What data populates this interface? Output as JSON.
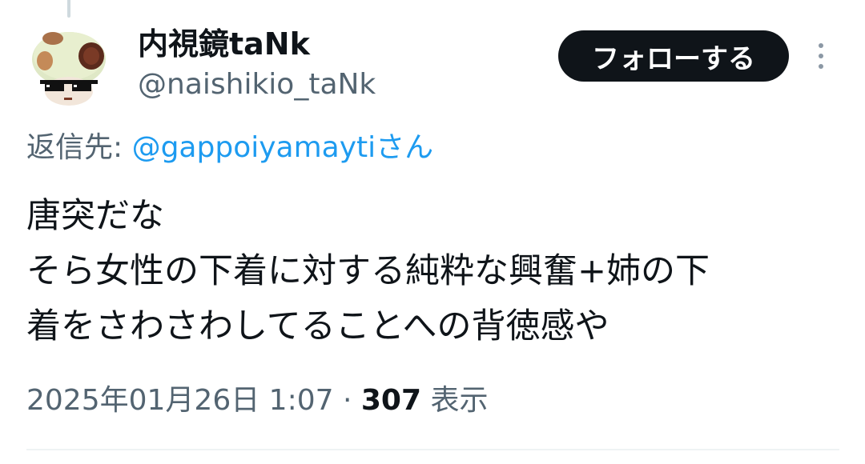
{
  "tweet": {
    "author": {
      "display_name": "内視鏡taNk",
      "handle": "@naishikio_taNk",
      "avatar_icon": "mushroom-with-sunglasses-avatar"
    },
    "follow_label": "フォローする",
    "more_icon": "more-vertical-icon",
    "reply_to": {
      "prefix": "返信先: ",
      "mention": "@gappoiyamayti",
      "suffix": "さん"
    },
    "text_lines": [
      "唐突だな",
      "そら女性の下着に対する純粋な興奮+姉の下",
      "着をさわさわしてることへの背徳感や"
    ],
    "timestamp": "2025年01月26日 1:07",
    "separator": " · ",
    "views_count": "307",
    "views_label": " 表示"
  },
  "colors": {
    "text_primary": "#0f1419",
    "text_secondary": "#536471",
    "link": "#1d9bf0",
    "button_bg": "#0f1419",
    "button_text": "#ffffff",
    "divider": "#eff3f4"
  }
}
